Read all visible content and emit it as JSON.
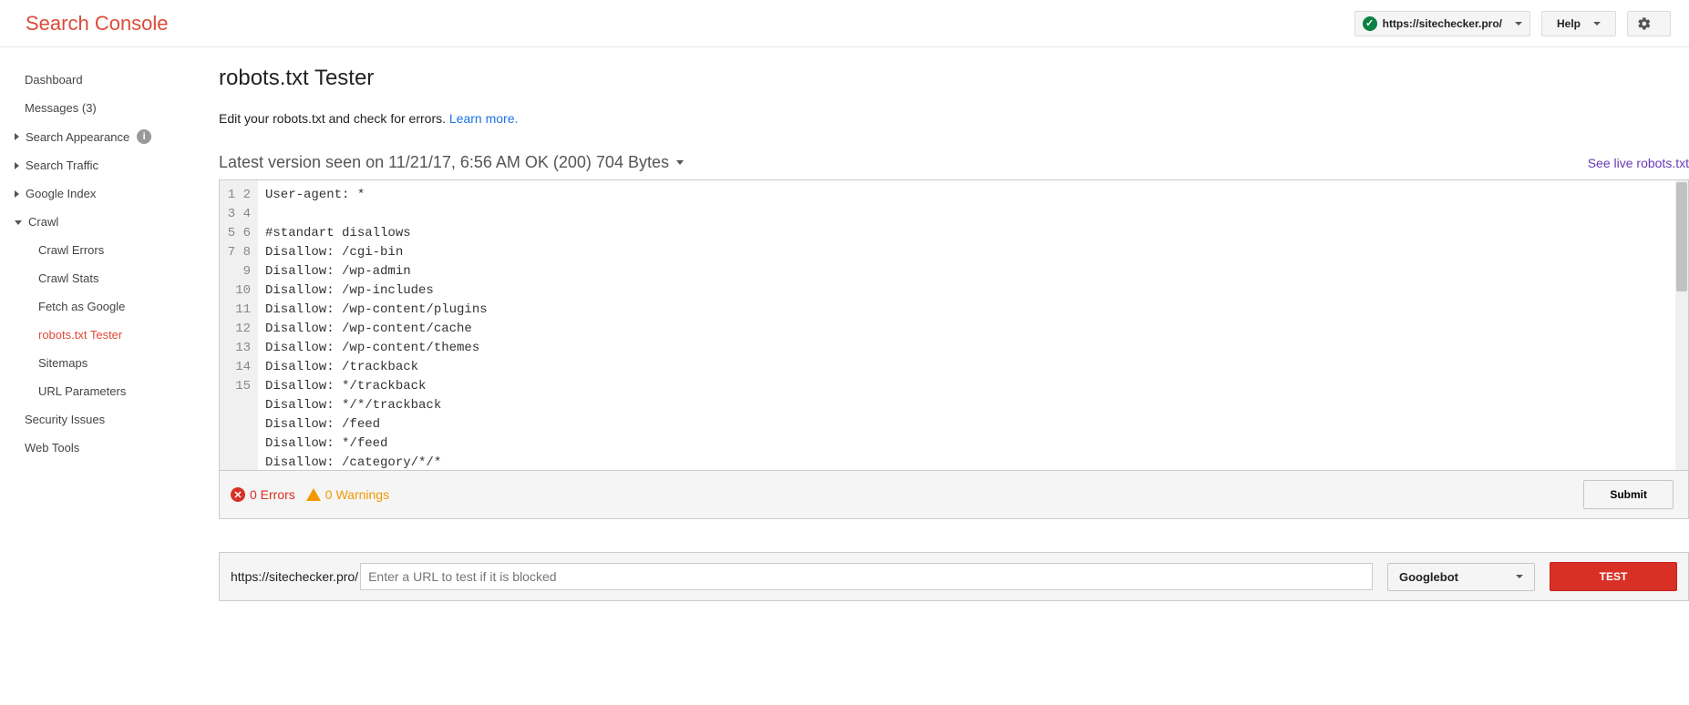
{
  "header": {
    "logo": "Search Console",
    "property_url": "https://sitechecker.pro/",
    "help_label": "Help"
  },
  "sidebar": {
    "dashboard": "Dashboard",
    "messages": "Messages (3)",
    "search_appearance": "Search Appearance",
    "search_traffic": "Search Traffic",
    "google_index": "Google Index",
    "crawl": "Crawl",
    "crawl_children": {
      "errors": "Crawl Errors",
      "stats": "Crawl Stats",
      "fetch": "Fetch as Google",
      "robots": "robots.txt Tester",
      "sitemaps": "Sitemaps",
      "url_params": "URL Parameters"
    },
    "security": "Security Issues",
    "web_tools": "Web Tools"
  },
  "main": {
    "title": "robots.txt Tester",
    "subtitle_text": "Edit your robots.txt and check for errors. ",
    "subtitle_link": "Learn more.",
    "version_text": "Latest version seen on 11/21/17, 6:56 AM OK (200) 704 Bytes",
    "live_link": "See live robots.txt",
    "code_lines": [
      "User-agent: *",
      "",
      "#standart disallows",
      "Disallow: /cgi-bin",
      "Disallow: /wp-admin",
      "Disallow: /wp-includes",
      "Disallow: /wp-content/plugins",
      "Disallow: /wp-content/cache",
      "Disallow: /wp-content/themes",
      "Disallow: /trackback",
      "Disallow: */trackback",
      "Disallow: */*/trackback",
      "Disallow: /feed",
      "Disallow: */feed",
      "Disallow: /category/*/*"
    ],
    "errors_text": "0 Errors",
    "warnings_text": "0 Warnings",
    "submit_label": "Submit",
    "test_prefix": "https://sitechecker.pro/",
    "test_placeholder": "Enter a URL to test if it is blocked",
    "bot_label": "Googlebot",
    "test_label": "TEST"
  }
}
